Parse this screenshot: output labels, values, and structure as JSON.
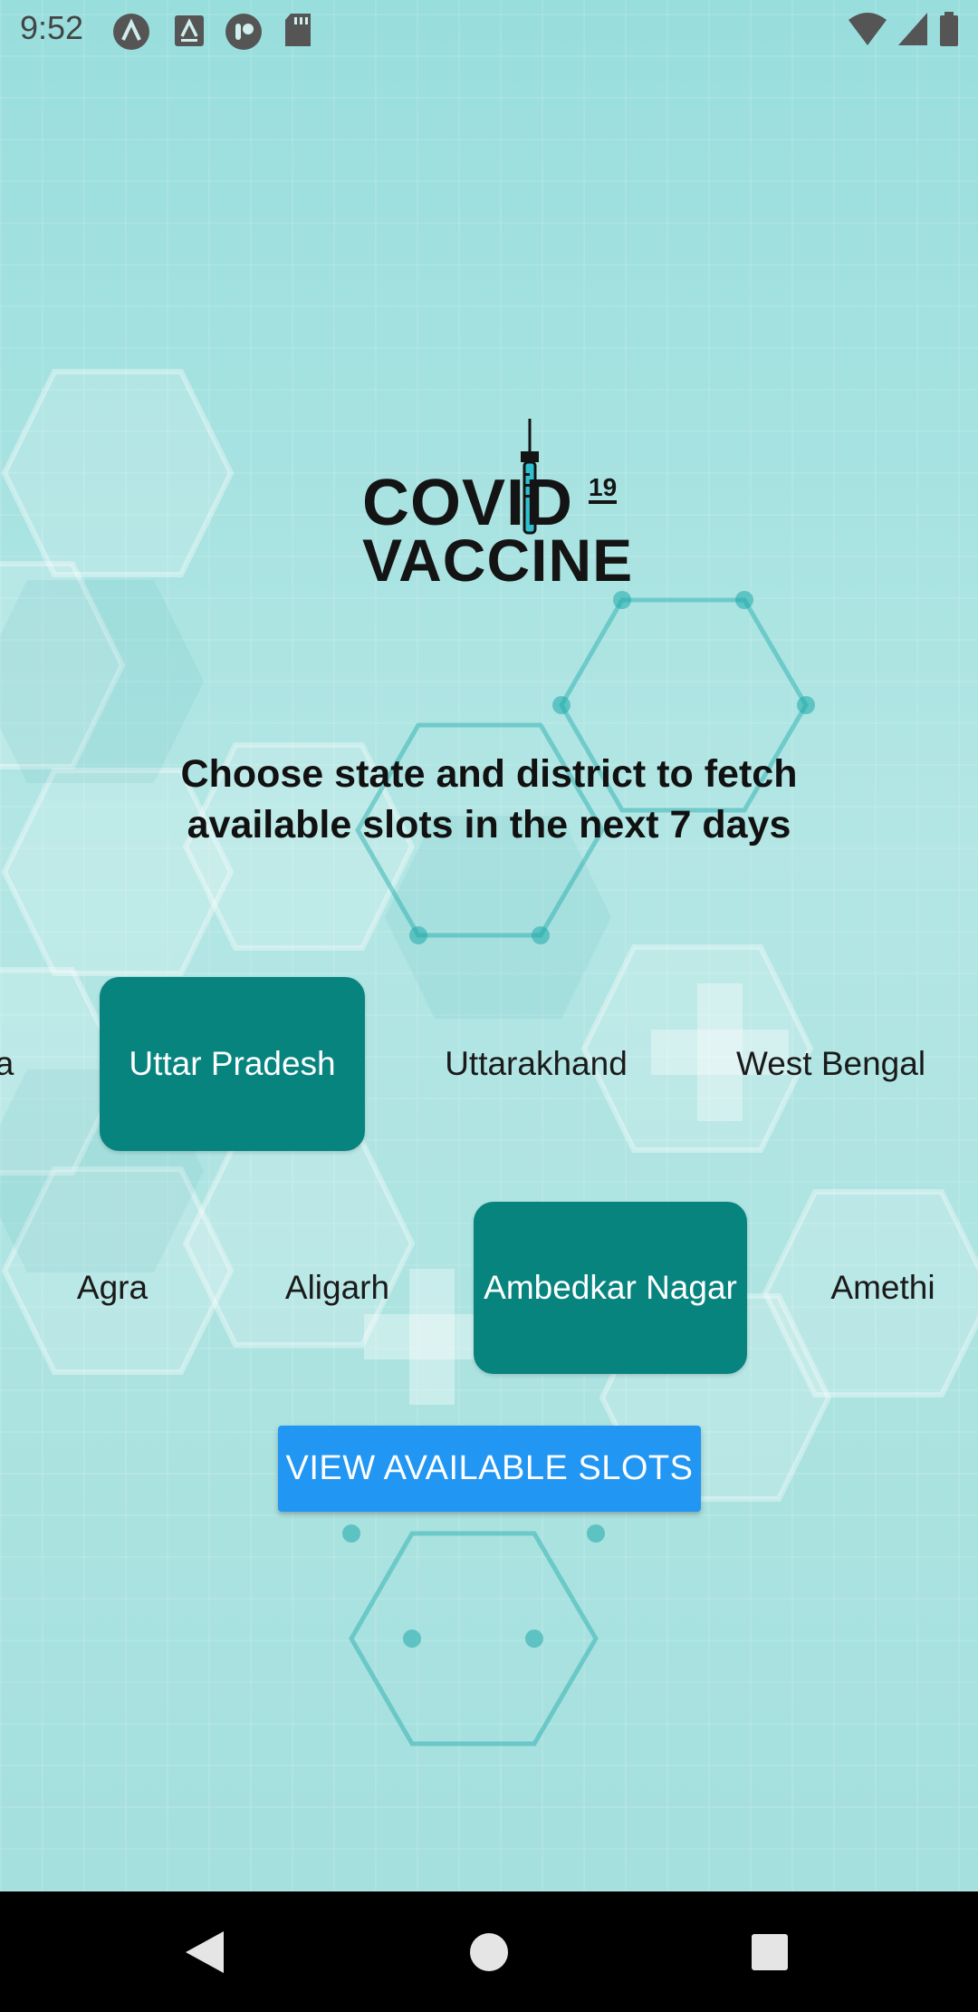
{
  "status_bar": {
    "time": "9:52",
    "left_icons": [
      "a-circle-icon",
      "a-box-icon",
      "assistant-icon",
      "sd-card-icon"
    ],
    "right_icons": [
      "wifi-icon",
      "signal-icon",
      "battery-icon"
    ]
  },
  "logo": {
    "line1": "COVID",
    "superscript": "19",
    "line2": "VACCINE"
  },
  "heading": "Choose state and district to fetch available slots in the next 7 days",
  "states": {
    "items": [
      "a",
      "Uttar Pradesh",
      "Uttarakhand",
      "West Bengal"
    ],
    "selected": "Uttar Pradesh"
  },
  "districts": {
    "items": [
      "Agra",
      "Aligarh",
      "Ambedkar Nagar",
      "Amethi"
    ],
    "selected": "Ambedkar Nagar"
  },
  "actions": {
    "view_slots": "VIEW AVAILABLE SLOTS"
  },
  "colors": {
    "accent": "#08847f",
    "button": "#2196f3",
    "background": "#a6e2e0"
  },
  "navigation": [
    "back-icon",
    "home-icon",
    "recents-icon"
  ]
}
